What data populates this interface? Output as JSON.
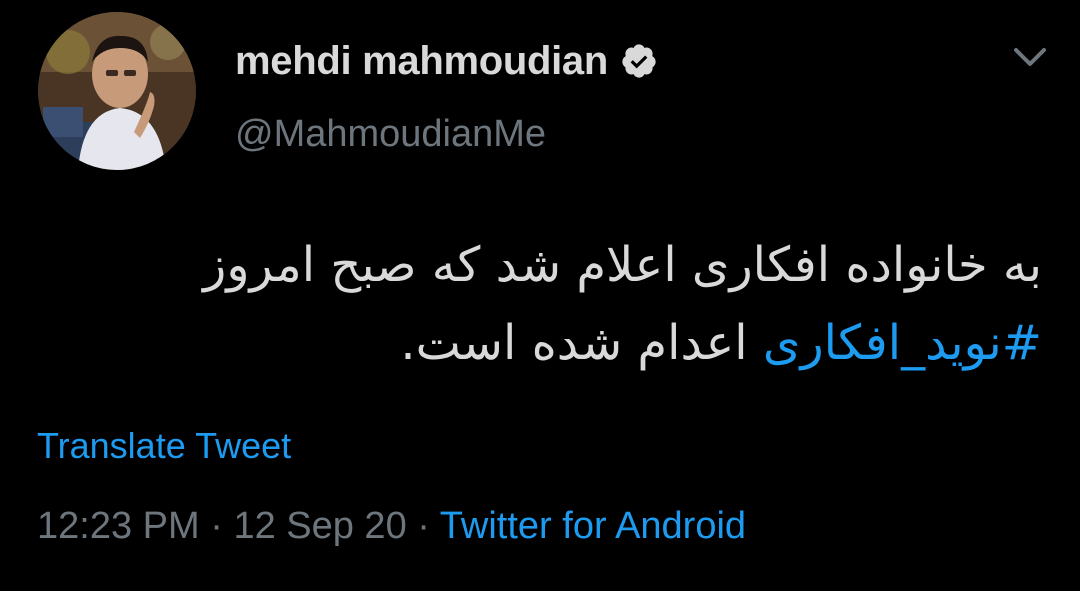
{
  "author": {
    "display_name": "mehdi mahmoudian",
    "handle": "@MahmoudianMe",
    "verified": true
  },
  "tweet": {
    "text_main": "به خانواده افکاری اعلام شد که صبح امروز",
    "hashtag": "#نوید_افکاری",
    "text_tail": " اعدام شده است."
  },
  "translate_label": "Translate Tweet",
  "meta": {
    "time": "12:23 PM",
    "separator": " · ",
    "date": "12 Sep 20",
    "source": "Twitter for Android"
  },
  "colors": {
    "background": "#000000",
    "text": "#d9d9d9",
    "secondary": "#6e767d",
    "accent": "#1d9bf0"
  },
  "icons": {
    "verified": "verified-badge-icon",
    "menu": "chevron-down-icon"
  }
}
